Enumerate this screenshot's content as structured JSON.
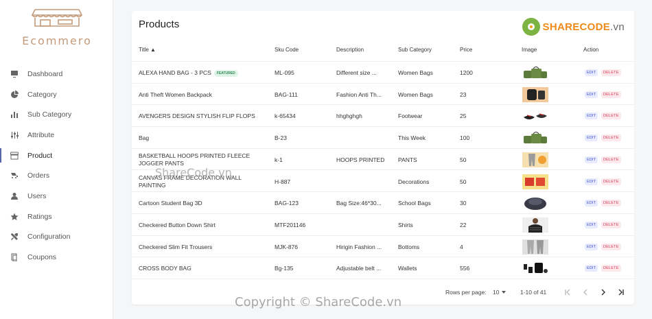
{
  "sidebar": {
    "logo_text": "Ecommero",
    "items": [
      {
        "label": "Dashboard",
        "icon": "monitor-icon"
      },
      {
        "label": "Category",
        "icon": "pie-icon"
      },
      {
        "label": "Sub Category",
        "icon": "bar-icon"
      },
      {
        "label": "Attribute",
        "icon": "sliders-icon"
      },
      {
        "label": "Product",
        "icon": "store-icon",
        "active": true
      },
      {
        "label": "Orders",
        "icon": "orders-icon"
      },
      {
        "label": "Users",
        "icon": "user-icon"
      },
      {
        "label": "Ratings",
        "icon": "star-icon"
      },
      {
        "label": "Configuration",
        "icon": "tools-icon"
      },
      {
        "label": "Coupons",
        "icon": "coupon-icon"
      }
    ]
  },
  "main": {
    "title": "Products",
    "brand": {
      "name": "SHARECODE",
      "domain": ".vn"
    },
    "columns": [
      "Title ▲",
      "Sku Code",
      "Description",
      "Sub Category",
      "Price",
      "Image",
      "Action"
    ],
    "rows": [
      {
        "title": "ALEXA HAND BAG - 3 PCS",
        "badge": "FEATURED",
        "sku": "ML-095",
        "desc": "Different size ...",
        "sub": "Women Bags",
        "price": "1200"
      },
      {
        "title": "Anti Theft Women Backpack",
        "sku": "BAG-111",
        "desc": "Fashion Anti Th...",
        "sub": "Women Bags",
        "price": "23"
      },
      {
        "title": "AVENGERS DESIGN STYLISH FLIP FLOPS",
        "sku": "k-65434",
        "desc": "hhghghgh",
        "sub": "Footwear",
        "price": "25"
      },
      {
        "title": "Bag",
        "sku": "B-23",
        "desc": "",
        "sub": "This Week",
        "price": "100"
      },
      {
        "title": "BASKETBALL HOOPS PRINTED FLEECE JOGGER PANTS",
        "sku": "k-1",
        "desc": "HOOPS PRINTED",
        "sub": "PANTS",
        "price": "50"
      },
      {
        "title": "CANVAS FRAME DECORATION WALL PAINTING",
        "sku": "H-887",
        "desc": "",
        "sub": "Decorations",
        "price": "50"
      },
      {
        "title": "Cartoon Student Bag 3D",
        "sku": "BAG-123",
        "desc": "Bag Size:46*30...",
        "sub": "School Bags",
        "price": "30"
      },
      {
        "title": "Checkered Button Down Shirt",
        "sku": "MTF201146",
        "desc": "",
        "sub": "Shirts",
        "price": "22"
      },
      {
        "title": "Checkered Slim Fit Trousers",
        "sku": "MJK-876",
        "desc": "Hirigin Fashion ...",
        "sub": "Bottoms",
        "price": "4"
      },
      {
        "title": "CROSS BODY BAG",
        "sku": "Bg-135",
        "desc": "Adjustable belt ...",
        "sub": "Wallets",
        "price": "556"
      }
    ],
    "action_edit": "EDIT",
    "action_delete": "DELETE",
    "footer": {
      "rows_per_page_label": "Rows per page:",
      "rows_per_page_value": "10",
      "range": "1-10 of 41"
    }
  },
  "watermark": {
    "center": "ShareCode.vn",
    "bottom": "Copyright © ShareCode.vn"
  }
}
